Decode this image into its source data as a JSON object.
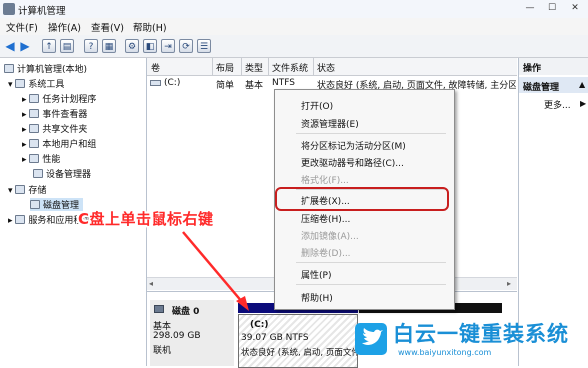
{
  "window": {
    "title": "计算机管理",
    "controls": [
      "—",
      "☐",
      "✕"
    ]
  },
  "menu": [
    "文件(F)",
    "操作(A)",
    "查看(V)",
    "帮助(H)"
  ],
  "toolbar_icons": [
    "back-icon",
    "forward-icon",
    "folder-up-icon",
    "console-tree-icon",
    "help-icon",
    "properties-icon",
    "settings-icon",
    "open-icon",
    "export-icon",
    "refresh-icon"
  ],
  "tree": {
    "root": "计算机管理(本地)",
    "items": [
      {
        "label": "系统工具",
        "level": 1,
        "expander": "▾"
      },
      {
        "label": "任务计划程序",
        "level": 2,
        "expander": "▸"
      },
      {
        "label": "事件查看器",
        "level": 2,
        "expander": "▸"
      },
      {
        "label": "共享文件夹",
        "level": 2,
        "expander": "▸"
      },
      {
        "label": "本地用户和组",
        "level": 2,
        "expander": "▸"
      },
      {
        "label": "性能",
        "level": 2,
        "expander": "▸"
      },
      {
        "label": "设备管理器",
        "level": 2,
        "expander": ""
      },
      {
        "label": "存储",
        "level": 1,
        "expander": "▾"
      },
      {
        "label": "磁盘管理",
        "level": 2,
        "expander": "",
        "selected": true
      },
      {
        "label": "服务和应用程序",
        "level": 1,
        "expander": "▸"
      }
    ]
  },
  "volume_table": {
    "headers": [
      "卷",
      "布局",
      "类型",
      "文件系统",
      "状态"
    ],
    "row": [
      "(C:)",
      "简单",
      "基本",
      "NTFS",
      "状态良好 (系统, 启动, 页面文件, 故障转储, 主分区"
    ]
  },
  "disk": {
    "name": "磁盘 0",
    "type": "基本",
    "size": "298.09 GB",
    "status": "联机",
    "partition": {
      "label": "(C:)",
      "size_fs": "39.07 GB NTFS",
      "status": "状态良好 (系统, 启动, 页面文件"
    }
  },
  "actions": {
    "header": "操作",
    "section": "磁盘管理",
    "more": "更多..."
  },
  "context_menu": [
    {
      "label": "打开(O)",
      "enabled": true
    },
    {
      "label": "资源管理器(E)",
      "enabled": true
    },
    {
      "separator": true
    },
    {
      "label": "将分区标记为活动分区(M)",
      "enabled": true
    },
    {
      "label": "更改驱动器号和路径(C)...",
      "enabled": true
    },
    {
      "label": "格式化(F)...",
      "enabled": false
    },
    {
      "separator": true
    },
    {
      "label": "扩展卷(X)...",
      "enabled": true,
      "highlighted": true
    },
    {
      "label": "压缩卷(H)...",
      "enabled": true
    },
    {
      "label": "添加镜像(A)...",
      "enabled": false
    },
    {
      "label": "删除卷(D)...",
      "enabled": false
    },
    {
      "separator": true
    },
    {
      "label": "属性(P)",
      "enabled": true
    },
    {
      "separator": true
    },
    {
      "label": "帮助(H)",
      "enabled": true
    }
  ],
  "annotation": "C盘上单击鼠标右键",
  "watermark": {
    "text": "白云一键重装系统",
    "url": "www.baiyunxitong.com"
  },
  "colors": {
    "annotation": "#ff2a2a",
    "highlight_border": "#c81e1e",
    "watermark": "#1a8fd6",
    "disk_bar": "#0b0b7a"
  }
}
